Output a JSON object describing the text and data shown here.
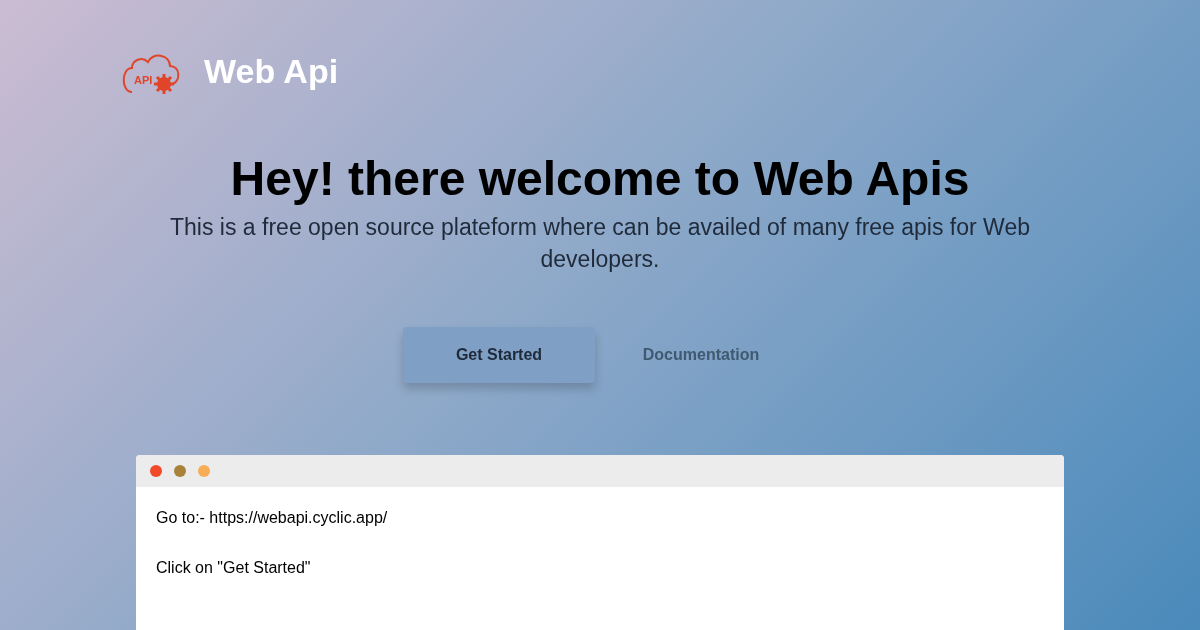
{
  "header": {
    "logo_text": "API",
    "title": "Web Api"
  },
  "hero": {
    "heading": "Hey! there welcome to Web Apis",
    "subtitle": "This is a free open source plateform where can be availed of many free apis for Web developers."
  },
  "buttons": [
    {
      "label": "Get Started",
      "kind": "primary"
    },
    {
      "label": "Documentation",
      "kind": "link"
    }
  ],
  "window": {
    "dots": [
      {
        "color": "#f04a2a"
      },
      {
        "color": "#a8823a"
      },
      {
        "color": "#f6ad55"
      }
    ],
    "lines": [
      "Go to:- https://webapi.cyclic.app/",
      "Click on \"Get Started\""
    ]
  }
}
